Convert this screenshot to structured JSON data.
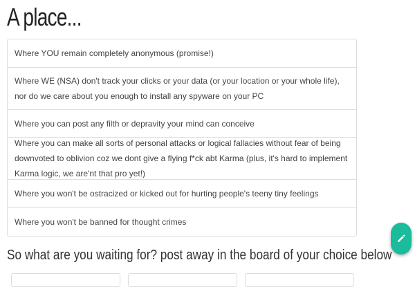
{
  "page": {
    "title": "A place...",
    "subtitle": "So what are you waiting for? post away in the board of your choice below"
  },
  "features": [
    {
      "text": "Where YOU remain completely anonymous (promise!)"
    },
    {
      "text": "Where WE (NSA) don't track your clicks or your data (or your location or your whole life), nor do we care about you enough to install any spyware on your PC"
    },
    {
      "text": "Where you can post any filth or depravity your mind can conceive"
    },
    {
      "text": "Where you can make all sorts of personal attacks or logical fallacies without fear of being downvoted to oblivion coz we dont give a flying f*ck abt Karma (plus, it's hard to implement Karma logic, we are'nt that pro yet!)"
    },
    {
      "text": "Where you won't be ostracized or kicked out for hurting people's teeny tiny feelings"
    },
    {
      "text": "Where you won't be banned for thought crimes"
    }
  ],
  "fab": {
    "icon": "pencil-icon",
    "color": "#1abc9c"
  },
  "colors": {
    "accent": "#1abc9c",
    "border": "#dddddd",
    "text": "#444444"
  }
}
